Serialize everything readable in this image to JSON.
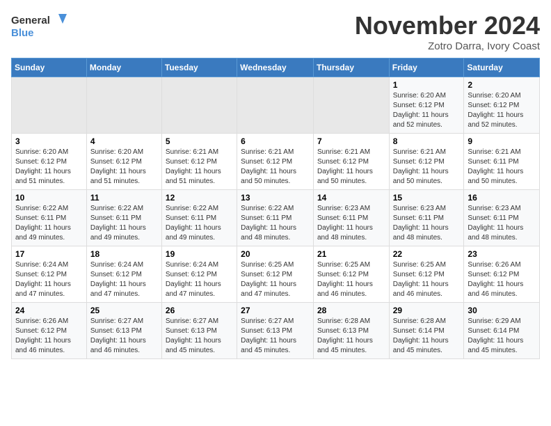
{
  "header": {
    "logo_line1": "General",
    "logo_line2": "Blue",
    "month": "November 2024",
    "location": "Zotro Darra, Ivory Coast"
  },
  "days_of_week": [
    "Sunday",
    "Monday",
    "Tuesday",
    "Wednesday",
    "Thursday",
    "Friday",
    "Saturday"
  ],
  "weeks": [
    [
      {
        "day": "",
        "info": ""
      },
      {
        "day": "",
        "info": ""
      },
      {
        "day": "",
        "info": ""
      },
      {
        "day": "",
        "info": ""
      },
      {
        "day": "",
        "info": ""
      },
      {
        "day": "1",
        "info": "Sunrise: 6:20 AM\nSunset: 6:12 PM\nDaylight: 11 hours and 52 minutes."
      },
      {
        "day": "2",
        "info": "Sunrise: 6:20 AM\nSunset: 6:12 PM\nDaylight: 11 hours and 52 minutes."
      }
    ],
    [
      {
        "day": "3",
        "info": "Sunrise: 6:20 AM\nSunset: 6:12 PM\nDaylight: 11 hours and 51 minutes."
      },
      {
        "day": "4",
        "info": "Sunrise: 6:20 AM\nSunset: 6:12 PM\nDaylight: 11 hours and 51 minutes."
      },
      {
        "day": "5",
        "info": "Sunrise: 6:21 AM\nSunset: 6:12 PM\nDaylight: 11 hours and 51 minutes."
      },
      {
        "day": "6",
        "info": "Sunrise: 6:21 AM\nSunset: 6:12 PM\nDaylight: 11 hours and 50 minutes."
      },
      {
        "day": "7",
        "info": "Sunrise: 6:21 AM\nSunset: 6:12 PM\nDaylight: 11 hours and 50 minutes."
      },
      {
        "day": "8",
        "info": "Sunrise: 6:21 AM\nSunset: 6:12 PM\nDaylight: 11 hours and 50 minutes."
      },
      {
        "day": "9",
        "info": "Sunrise: 6:21 AM\nSunset: 6:11 PM\nDaylight: 11 hours and 50 minutes."
      }
    ],
    [
      {
        "day": "10",
        "info": "Sunrise: 6:22 AM\nSunset: 6:11 PM\nDaylight: 11 hours and 49 minutes."
      },
      {
        "day": "11",
        "info": "Sunrise: 6:22 AM\nSunset: 6:11 PM\nDaylight: 11 hours and 49 minutes."
      },
      {
        "day": "12",
        "info": "Sunrise: 6:22 AM\nSunset: 6:11 PM\nDaylight: 11 hours and 49 minutes."
      },
      {
        "day": "13",
        "info": "Sunrise: 6:22 AM\nSunset: 6:11 PM\nDaylight: 11 hours and 48 minutes."
      },
      {
        "day": "14",
        "info": "Sunrise: 6:23 AM\nSunset: 6:11 PM\nDaylight: 11 hours and 48 minutes."
      },
      {
        "day": "15",
        "info": "Sunrise: 6:23 AM\nSunset: 6:11 PM\nDaylight: 11 hours and 48 minutes."
      },
      {
        "day": "16",
        "info": "Sunrise: 6:23 AM\nSunset: 6:11 PM\nDaylight: 11 hours and 48 minutes."
      }
    ],
    [
      {
        "day": "17",
        "info": "Sunrise: 6:24 AM\nSunset: 6:12 PM\nDaylight: 11 hours and 47 minutes."
      },
      {
        "day": "18",
        "info": "Sunrise: 6:24 AM\nSunset: 6:12 PM\nDaylight: 11 hours and 47 minutes."
      },
      {
        "day": "19",
        "info": "Sunrise: 6:24 AM\nSunset: 6:12 PM\nDaylight: 11 hours and 47 minutes."
      },
      {
        "day": "20",
        "info": "Sunrise: 6:25 AM\nSunset: 6:12 PM\nDaylight: 11 hours and 47 minutes."
      },
      {
        "day": "21",
        "info": "Sunrise: 6:25 AM\nSunset: 6:12 PM\nDaylight: 11 hours and 46 minutes."
      },
      {
        "day": "22",
        "info": "Sunrise: 6:25 AM\nSunset: 6:12 PM\nDaylight: 11 hours and 46 minutes."
      },
      {
        "day": "23",
        "info": "Sunrise: 6:26 AM\nSunset: 6:12 PM\nDaylight: 11 hours and 46 minutes."
      }
    ],
    [
      {
        "day": "24",
        "info": "Sunrise: 6:26 AM\nSunset: 6:12 PM\nDaylight: 11 hours and 46 minutes."
      },
      {
        "day": "25",
        "info": "Sunrise: 6:27 AM\nSunset: 6:13 PM\nDaylight: 11 hours and 46 minutes."
      },
      {
        "day": "26",
        "info": "Sunrise: 6:27 AM\nSunset: 6:13 PM\nDaylight: 11 hours and 45 minutes."
      },
      {
        "day": "27",
        "info": "Sunrise: 6:27 AM\nSunset: 6:13 PM\nDaylight: 11 hours and 45 minutes."
      },
      {
        "day": "28",
        "info": "Sunrise: 6:28 AM\nSunset: 6:13 PM\nDaylight: 11 hours and 45 minutes."
      },
      {
        "day": "29",
        "info": "Sunrise: 6:28 AM\nSunset: 6:14 PM\nDaylight: 11 hours and 45 minutes."
      },
      {
        "day": "30",
        "info": "Sunrise: 6:29 AM\nSunset: 6:14 PM\nDaylight: 11 hours and 45 minutes."
      }
    ]
  ]
}
